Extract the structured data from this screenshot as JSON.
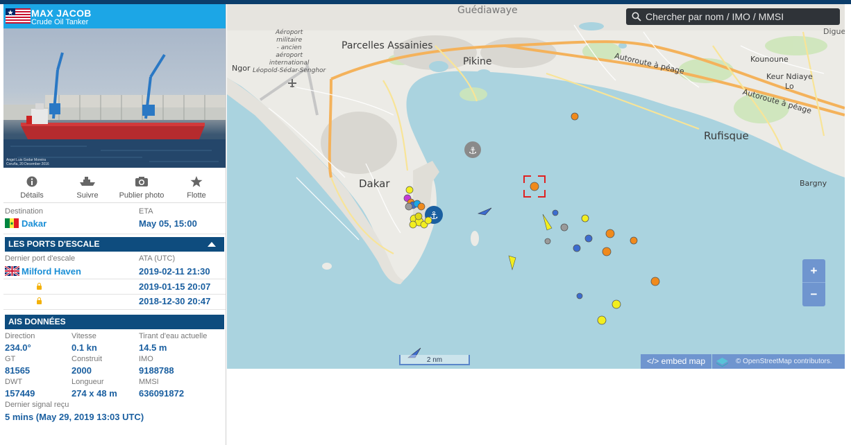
{
  "vessel": {
    "name": "MAX JACOB",
    "type": "Crude Oil Tanker",
    "photo_caption": "Angel Luis Godar Moreira\nCoruña, 20 December 2016"
  },
  "tabs": [
    {
      "label": "Détails",
      "icon": "info-icon"
    },
    {
      "label": "Suivre",
      "icon": "ship-icon"
    },
    {
      "label": "Publier photo",
      "icon": "camera-icon"
    },
    {
      "label": "Flotte",
      "icon": "star-icon"
    }
  ],
  "voyage": {
    "destination_label": "Destination",
    "destination_value": "Dakar",
    "eta_label": "ETA",
    "eta_value": "May 05, 15:00"
  },
  "ports": {
    "section_title": "LES PORTS D'ESCALE",
    "last_port_label": "Dernier port d'escale",
    "ata_label": "ATA (UTC)",
    "entries": [
      {
        "port": "Milford Haven",
        "ata": "2019-02-11 21:30"
      },
      {
        "port": "",
        "ata": "2019-01-15 20:07"
      },
      {
        "port": "",
        "ata": "2018-12-30 20:47"
      }
    ]
  },
  "ais": {
    "section_title": "AIS DONNÉES",
    "fields": [
      {
        "label": "Direction",
        "value": "234.0°"
      },
      {
        "label": "Vitesse",
        "value": "0.1 kn"
      },
      {
        "label": "Tirant d'eau actuelle",
        "value": "14.5 m"
      },
      {
        "label": "GT",
        "value": "81565"
      },
      {
        "label": "Construit",
        "value": "2000"
      },
      {
        "label": "IMO",
        "value": "9188788"
      },
      {
        "label": "DWT",
        "value": "157449"
      },
      {
        "label": "Longueur",
        "value": "274 x 48 m"
      },
      {
        "label": "MMSI",
        "value": "636091872"
      }
    ],
    "last_signal_label": "Dernier signal reçu",
    "last_signal_value": "5 mins (May 29, 2019 13:03 UTC)"
  },
  "map": {
    "search_placeholder": "Chercher par nom / IMO / MMSI",
    "labels": {
      "guediawaye": "Guédiawaye",
      "digue": "Digue",
      "aeroport": "Aéroport\nmilitaire\n- ancien\naéroport\ninternational\nLéopold-Sédar-Senghor",
      "parcelles": "Parcelles Assainies",
      "pikine": "Pikine",
      "ngor": "Ngor",
      "autoroute1": "Autoroute à péage",
      "autoroute2": "Autoroute à péage",
      "kounoune": "Kounoune",
      "keur_ndiaye": "Keur Ndiaye\nLo",
      "rufisque": "Rufisque",
      "dakar": "Dakar",
      "bargny": "Bargny"
    },
    "zoom_in": "+",
    "zoom_out": "−",
    "scale": "2 nm",
    "embed_label": "</> embed map",
    "attribution": "© OpenStreetMap contributors."
  },
  "colors": {
    "header_blue": "#1ca6e6",
    "section_navy": "#0e4c7e",
    "value_blue": "#1a5fa0",
    "sea": "#aad3df",
    "land": "#ecebe6",
    "vessel_orange": "#f08a1c",
    "vessel_yellow": "#f2ee1f",
    "vessel_blue": "#3c6ccf"
  }
}
